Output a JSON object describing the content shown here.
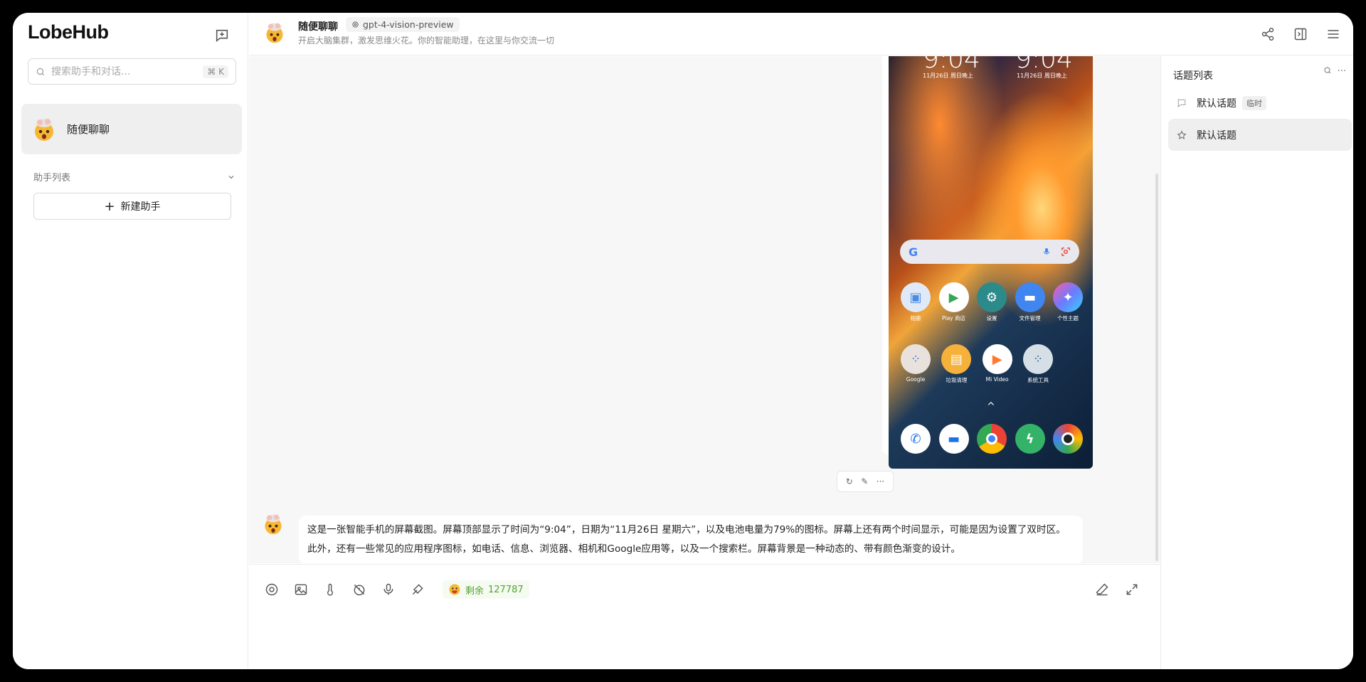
{
  "app": {
    "brand": "LobeHub"
  },
  "sidebar": {
    "search_placeholder": "搜索助手和对话...",
    "search_shortcut": "⌘ K",
    "active_session": "随便聊聊",
    "group_label": "助手列表",
    "new_agent_label": "新建助手"
  },
  "header": {
    "title": "随便聊聊",
    "model": "gpt-4-vision-preview",
    "description": "开启大脑集群，激发思维火花。你的智能助理，在这里与你交流一切"
  },
  "phone": {
    "time_left": "9:04",
    "time_right": "9:04",
    "date_left": "11月26日 周日晚上",
    "date_right": "11月26日 周日晚上",
    "row1": [
      "相册",
      "Play 商店",
      "设置",
      "文件管理",
      "个性主题"
    ],
    "row2": [
      "Google",
      "垃圾清理",
      "Mi Video",
      "系统工具"
    ]
  },
  "message": {
    "text": "这是一张智能手机的屏幕截图。屏幕顶部显示了时间为“9:04”，日期为“11月26日 星期六”，以及电池电量为79%的图标。屏幕上还有两个时间显示，可能是因为设置了双时区。此外，还有一些常见的应用程序图标，如电话、信息、浏览器、相机和Google应用等，以及一个搜索栏。屏幕背景是一种动态的、带有颜色渐变的设计。"
  },
  "input": {
    "token_label": "剩余",
    "token_count": "127787"
  },
  "topics": {
    "title": "话题列表",
    "items": [
      {
        "label": "默认话题",
        "badge": "临时"
      },
      {
        "label": "默认话题"
      }
    ]
  },
  "colors": {
    "token_green": "#52a332",
    "active_bg": "#efefef"
  }
}
